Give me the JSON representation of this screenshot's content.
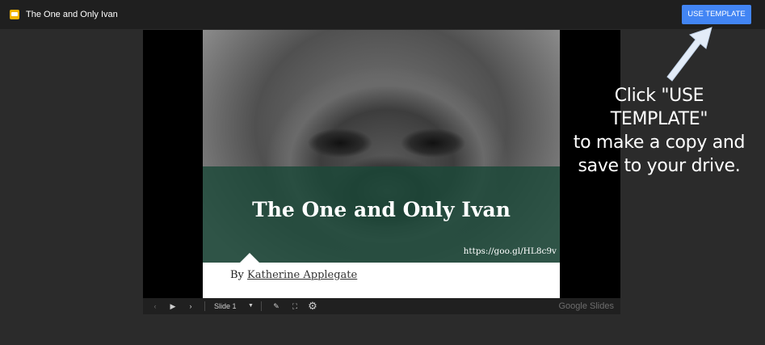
{
  "app": {
    "title": "The One and Only Ivan",
    "icon": "slides-icon",
    "accent_color": "#4285f4"
  },
  "toolbar": {
    "use_template_label": "USE TEMPLATE"
  },
  "slide": {
    "title": "The One and Only Ivan",
    "url": "https://goo.gl/HL8c9v",
    "byline_prefix": "By ",
    "author": "Katherine Applegate",
    "band_color": "#1b4838"
  },
  "controls": {
    "prev_icon": "‹",
    "play_icon": "▶",
    "next_icon": "›",
    "slide_label": "Slide 1",
    "chevron_icon": "▼",
    "pen_icon": "✎",
    "fullscreen_icon": "⛶",
    "gear_icon": "⚙",
    "brand": "Google Slides"
  },
  "instruction": {
    "line1": "Click \"USE TEMPLATE\"",
    "line2": "to make a copy and",
    "line3": "save to your drive."
  }
}
